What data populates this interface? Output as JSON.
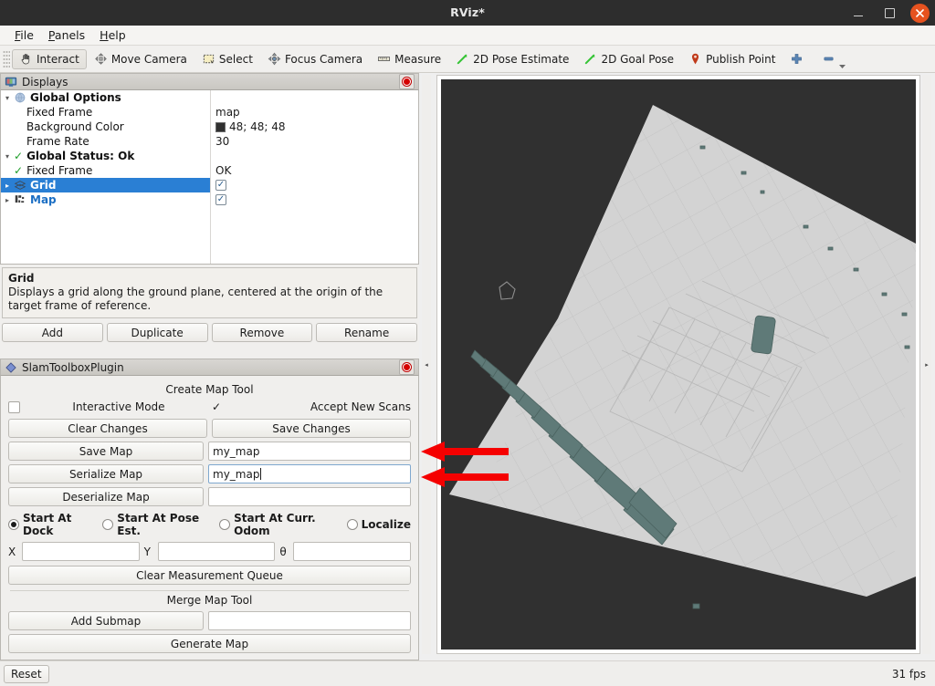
{
  "window": {
    "title": "RViz*",
    "minimize_label": "–",
    "maximize_label": "□",
    "close_label": "✕"
  },
  "menubar": {
    "items": [
      {
        "label": "File",
        "mnemonic": "F"
      },
      {
        "label": "Panels",
        "mnemonic": "P"
      },
      {
        "label": "Help",
        "mnemonic": "H"
      }
    ]
  },
  "toolbar": {
    "items": [
      {
        "label": "Interact",
        "icon": "hand-cursor-icon",
        "active": true
      },
      {
        "label": "Move Camera",
        "icon": "move-camera-icon",
        "active": false
      },
      {
        "label": "Select",
        "icon": "select-rect-icon",
        "active": false
      },
      {
        "label": "Focus Camera",
        "icon": "focus-camera-icon",
        "active": false
      },
      {
        "label": "Measure",
        "icon": "measure-ruler-icon",
        "active": false
      },
      {
        "label": "2D Pose Estimate",
        "icon": "pose-arrow-icon",
        "active": false
      },
      {
        "label": "2D Goal Pose",
        "icon": "goal-arrow-icon",
        "active": false
      },
      {
        "label": "Publish Point",
        "icon": "map-pin-icon",
        "active": false
      },
      {
        "label": "",
        "icon": "plus-icon",
        "active": false
      },
      {
        "label": "",
        "icon": "minus-icon",
        "active": false
      }
    ]
  },
  "displays": {
    "title": "Displays",
    "close_label": "",
    "tree": [
      {
        "name": "Global Options",
        "value": "",
        "icon": "globe-icon",
        "indent": 0,
        "expander": "▾",
        "selected": false,
        "kind": "group"
      },
      {
        "name": "Fixed Frame",
        "value": "map",
        "icon": "",
        "indent": 1,
        "expander": "",
        "selected": false,
        "kind": "text"
      },
      {
        "name": "Background Color",
        "value": "48; 48; 48",
        "icon": "",
        "indent": 1,
        "expander": "",
        "selected": false,
        "kind": "color",
        "swatch": "#303030"
      },
      {
        "name": "Frame Rate",
        "value": "30",
        "icon": "",
        "indent": 1,
        "expander": "",
        "selected": false,
        "kind": "text"
      },
      {
        "name": "Global Status: Ok",
        "value": "",
        "icon": "green-check-icon",
        "indent": 0,
        "expander": "▾",
        "selected": false,
        "kind": "status"
      },
      {
        "name": "Fixed Frame",
        "value": "OK",
        "icon": "green-check-icon",
        "indent": 1,
        "expander": "",
        "selected": false,
        "kind": "status"
      },
      {
        "name": "Grid",
        "value": "",
        "icon": "grid-icon",
        "indent": 0,
        "expander": "▸",
        "selected": true,
        "kind": "display",
        "checked": true
      },
      {
        "name": "Map",
        "value": "",
        "icon": "map-icon",
        "indent": 0,
        "expander": "▸",
        "selected": false,
        "kind": "display",
        "checked": true
      }
    ]
  },
  "description": {
    "title": "Grid",
    "text": "Displays a grid along the ground plane, centered at the origin of the target frame of reference."
  },
  "display_buttons": [
    {
      "label": "Add"
    },
    {
      "label": "Duplicate"
    },
    {
      "label": "Remove"
    },
    {
      "label": "Rename"
    }
  ],
  "slam_panel": {
    "title": "SlamToolboxPlugin",
    "create_map_tool_label": "Create Map Tool",
    "interactive_mode_label": "Interactive Mode",
    "accept_new_scans_label": "Accept New Scans",
    "interactive_checkbox_checked": false,
    "interactive_mode_check_glyph": "✓",
    "clear_changes_label": "Clear Changes",
    "save_changes_label": "Save Changes",
    "save_map_label": "Save Map",
    "save_map_value": "my_map",
    "serialize_map_label": "Serialize Map",
    "serialize_map_value": "my_map",
    "deserialize_map_label": "Deserialize Map",
    "deserialize_map_value": "",
    "start_options": [
      {
        "label": "Start At Dock",
        "selected": true
      },
      {
        "label": "Start At Pose Est.",
        "selected": false
      },
      {
        "label": "Start At Curr. Odom",
        "selected": false
      },
      {
        "label": "Localize",
        "selected": false
      }
    ],
    "x_label": "X",
    "x_value": "",
    "y_label": "Y",
    "y_value": "",
    "theta_label": "θ",
    "theta_value": "",
    "clear_queue_label": "Clear Measurement Queue",
    "merge_map_tool_label": "Merge Map Tool",
    "add_submap_label": "Add Submap",
    "add_submap_value": "",
    "generate_map_label": "Generate Map"
  },
  "viewport": {
    "background_color": "#303030",
    "map_color": "#d3d3d3",
    "obstacle_color": "#5f7a78",
    "grid_color": "#b9b9b9"
  },
  "annotations": {
    "arrow_color": "#f50000",
    "arrows": [
      {
        "name": "save-map-field-arrow",
        "points_at": "save_map_value"
      },
      {
        "name": "serialize-map-field-arrow",
        "points_at": "serialize_map_value"
      }
    ]
  },
  "splitters": {
    "left_glyph": "◂",
    "right_glyph": "▸"
  },
  "statusbar": {
    "reset_label": "Reset",
    "fps_label": "31 fps"
  }
}
